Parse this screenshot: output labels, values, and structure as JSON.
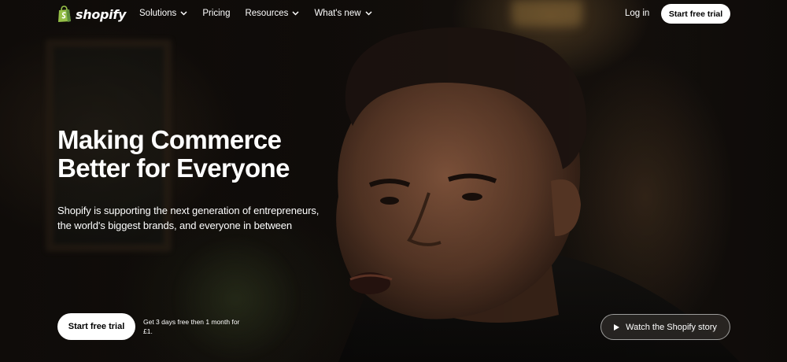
{
  "brand": {
    "name": "shopify",
    "logo_icon": "shopping-bag-icon",
    "logo_color": "#95BF47"
  },
  "nav": {
    "items": [
      {
        "label": "Solutions",
        "has_dropdown": true
      },
      {
        "label": "Pricing",
        "has_dropdown": false
      },
      {
        "label": "Resources",
        "has_dropdown": true
      },
      {
        "label": "What's new",
        "has_dropdown": true
      }
    ],
    "login_label": "Log in",
    "cta_label": "Start free trial"
  },
  "hero": {
    "headline_line1": "Making Commerce",
    "headline_line2": "Better for Everyone",
    "sub_line1": "Shopify is supporting the next generation of entrepreneurs,",
    "sub_line2": "the world's biggest brands, and everyone in between",
    "cta_label": "Start free trial",
    "promo_text": "Get 3 days free then 1 month for £1.",
    "video_label": "Watch the Shopify story",
    "video_icon": "play-icon"
  },
  "colors": {
    "button_bg": "#FFFFFF",
    "button_text": "#000000",
    "text": "#FFFFFF"
  }
}
